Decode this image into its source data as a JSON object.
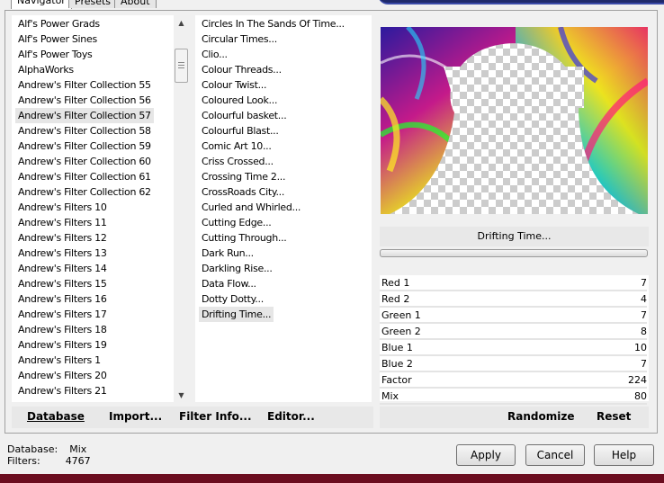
{
  "tabs": [
    "Navigator",
    "Presets",
    "About"
  ],
  "categories": [
    "Alf's Power Grads",
    "Alf's Power Sines",
    "Alf's Power Toys",
    "AlphaWorks",
    "Andrew's Filter Collection 55",
    "Andrew's Filter Collection 56",
    "Andrew's Filter Collection 57",
    "Andrew's Filter Collection 58",
    "Andrew's Filter Collection 59",
    "Andrew's Filter Collection 60",
    "Andrew's Filter Collection 61",
    "Andrew's Filter Collection 62",
    "Andrew's Filters 10",
    "Andrew's Filters 11",
    "Andrew's Filters 12",
    "Andrew's Filters 13",
    "Andrew's Filters 14",
    "Andrew's Filters 15",
    "Andrew's Filters 16",
    "Andrew's Filters 17",
    "Andrew's Filters 18",
    "Andrew's Filters 19",
    "Andrew's Filters 1",
    "Andrew's Filters 20",
    "Andrew's Filters 21"
  ],
  "selected_category": "Andrew's Filter Collection 57",
  "filters": [
    "Circles In The Sands Of Time...",
    "Circular Times...",
    "Clio...",
    "Colour Threads...",
    "Colour Twist...",
    "Coloured Look...",
    "Colourful basket...",
    "Colourful Blast...",
    "Comic Art 10...",
    "Criss Crossed...",
    "Crossing Time 2...",
    "CrossRoads City...",
    "Curled and Whirled...",
    "Cutting Edge...",
    "Cutting Through...",
    "Dark Run...",
    "Darkling Rise...",
    "Data Flow...",
    "Dotty Dotty...",
    "Drifting Time..."
  ],
  "selected_filter": "Drifting Time...",
  "current_filter_name": "Drifting Time...",
  "params": [
    {
      "label": "Red 1",
      "value": "7"
    },
    {
      "label": "Red 2",
      "value": "4"
    },
    {
      "label": "Green 1",
      "value": "7"
    },
    {
      "label": "Green 2",
      "value": "8"
    },
    {
      "label": "Blue 1",
      "value": "10"
    },
    {
      "label": "Blue 2",
      "value": "7"
    },
    {
      "label": "Factor",
      "value": "224"
    },
    {
      "label": "Mix",
      "value": "80"
    }
  ],
  "left_buttons": {
    "database": "Database",
    "import": "Import...",
    "filter_info": "Filter Info...",
    "editor": "Editor..."
  },
  "right_buttons": {
    "randomize": "Randomize",
    "reset": "Reset"
  },
  "status": {
    "database_label": "Database:",
    "database_value": "Mix",
    "filters_label": "Filters:",
    "filters_value": "4767"
  },
  "dialog_buttons": {
    "apply": "Apply",
    "cancel": "Cancel",
    "help": "Help"
  }
}
